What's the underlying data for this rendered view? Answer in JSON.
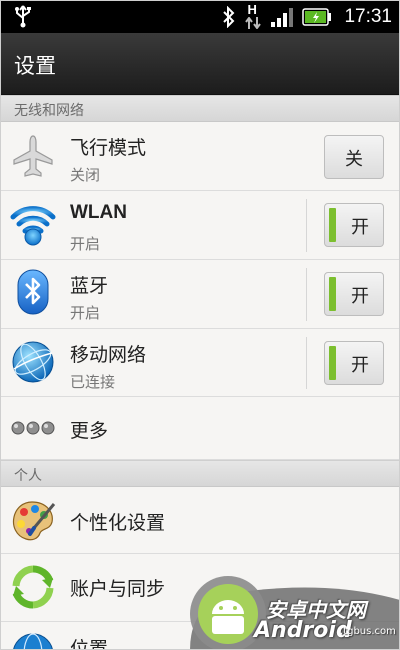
{
  "status_bar": {
    "time": "17:31",
    "network_type": "H",
    "battery_color": "#5bb823"
  },
  "action_bar": {
    "title": "设置"
  },
  "sections": {
    "wireless": "无线和网络",
    "personal": "个人"
  },
  "items": {
    "airplane": {
      "title": "飞行模式",
      "summary": "关闭",
      "toggle": "关",
      "icon": "airplane-icon",
      "checked": false
    },
    "wlan": {
      "title": "WLAN",
      "summary": "开启",
      "toggle": "开",
      "icon": "wifi-icon",
      "checked": true
    },
    "bluetooth": {
      "title": "蓝牙",
      "summary": "开启",
      "toggle": "开",
      "icon": "bluetooth-icon",
      "checked": true
    },
    "mobile": {
      "title": "移动网络",
      "summary": "已连接",
      "toggle": "开",
      "icon": "globe-icon",
      "checked": true
    },
    "more": {
      "title": "更多",
      "icon": "more-dots-icon"
    },
    "personalize": {
      "title": "个性化设置",
      "icon": "palette-icon"
    },
    "accounts": {
      "title": "账户与同步",
      "icon": "sync-icon"
    },
    "location": {
      "title": "位置",
      "icon": "location-globe-icon"
    }
  },
  "watermark": {
    "line1": "安卓中文网",
    "line2": "Android",
    "line3": ".tgbus.com"
  },
  "colors": {
    "toggle_on": "#7cbf2f",
    "accent": "#1b8fd6"
  }
}
